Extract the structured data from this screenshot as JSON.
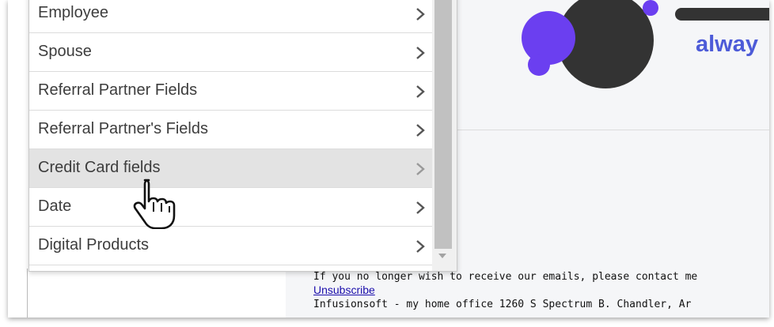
{
  "menu": {
    "items": [
      {
        "label": "Employee",
        "hovered": false
      },
      {
        "label": "Spouse",
        "hovered": false
      },
      {
        "label": "Referral Partner Fields",
        "hovered": false
      },
      {
        "label": "Referral Partner's Fields",
        "hovered": false
      },
      {
        "label": "Credit Card fields",
        "hovered": true
      },
      {
        "label": "Date",
        "hovered": false
      },
      {
        "label": "Digital Products",
        "hovered": false
      }
    ],
    "chevron_icon": "chevron-right-icon"
  },
  "preview": {
    "logo_text": "alway",
    "footer_line1": "If you no longer wish to receive our emails, please contact me",
    "unsubscribe_label": "Unsubscribe",
    "footer_line3": "Infusionsoft - my home office 1260 S Spectrum B. Chandler, Ar"
  },
  "colors": {
    "brand_purple": "#6b3ff0",
    "logo_dark": "#333333",
    "logo_text": "#4d5bd8",
    "hover_bg": "#e3e3e3",
    "link": "#1a0dab"
  }
}
